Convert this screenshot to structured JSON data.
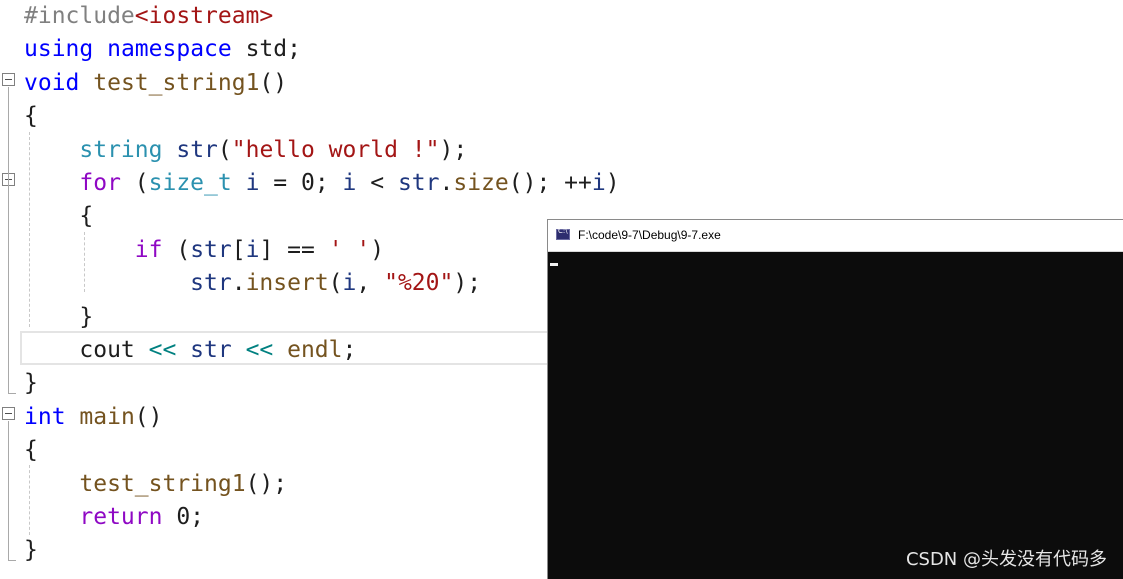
{
  "colors": {
    "preprocessor": "#808080",
    "keyword": "#0000ff",
    "control": "#8f08c4",
    "type": "#2b91af",
    "function": "#74531f",
    "string": "#a31515",
    "plain": "#1e1e1e",
    "console_bg": "#0c0c0c"
  },
  "editor": {
    "lines": [
      {
        "segments": [
          {
            "text": "#include",
            "color": "#808080"
          },
          {
            "text": "<iostream>",
            "color": "#a31515"
          }
        ]
      },
      {
        "segments": [
          {
            "text": "using",
            "color": "#0000ff"
          },
          {
            "text": " ",
            "color": "#1e1e1e"
          },
          {
            "text": "namespace",
            "color": "#0000ff"
          },
          {
            "text": " std;",
            "color": "#1e1e1e"
          }
        ]
      },
      {
        "segments": [
          {
            "text": "void",
            "color": "#0000ff"
          },
          {
            "text": " ",
            "color": "#1e1e1e"
          },
          {
            "text": "test_string1",
            "color": "#74531f"
          },
          {
            "text": "()",
            "color": "#1e1e1e"
          }
        ]
      },
      {
        "segments": [
          {
            "text": "{",
            "color": "#1e1e1e"
          }
        ]
      },
      {
        "segments": [
          {
            "text": "    ",
            "color": "#1e1e1e"
          },
          {
            "text": "string",
            "color": "#2b91af"
          },
          {
            "text": " ",
            "color": "#1e1e1e"
          },
          {
            "text": "str",
            "color": "#1f377f"
          },
          {
            "text": "(",
            "color": "#1e1e1e"
          },
          {
            "text": "\"hello world !\"",
            "color": "#a31515"
          },
          {
            "text": ");",
            "color": "#1e1e1e"
          }
        ]
      },
      {
        "segments": [
          {
            "text": "    ",
            "color": "#1e1e1e"
          },
          {
            "text": "for",
            "color": "#8f08c4"
          },
          {
            "text": " (",
            "color": "#1e1e1e"
          },
          {
            "text": "size_t",
            "color": "#2b91af"
          },
          {
            "text": " ",
            "color": "#1e1e1e"
          },
          {
            "text": "i",
            "color": "#1f377f"
          },
          {
            "text": " = 0; ",
            "color": "#1e1e1e"
          },
          {
            "text": "i",
            "color": "#1f377f"
          },
          {
            "text": " < ",
            "color": "#1e1e1e"
          },
          {
            "text": "str",
            "color": "#1f377f"
          },
          {
            "text": ".",
            "color": "#1e1e1e"
          },
          {
            "text": "size",
            "color": "#74531f"
          },
          {
            "text": "(); ++",
            "color": "#1e1e1e"
          },
          {
            "text": "i",
            "color": "#1f377f"
          },
          {
            "text": ")",
            "color": "#1e1e1e"
          }
        ]
      },
      {
        "segments": [
          {
            "text": "    {",
            "color": "#1e1e1e"
          }
        ]
      },
      {
        "segments": [
          {
            "text": "        ",
            "color": "#1e1e1e"
          },
          {
            "text": "if",
            "color": "#8f08c4"
          },
          {
            "text": " (",
            "color": "#1e1e1e"
          },
          {
            "text": "str",
            "color": "#1f377f"
          },
          {
            "text": "[",
            "color": "#1e1e1e"
          },
          {
            "text": "i",
            "color": "#1f377f"
          },
          {
            "text": "] == ",
            "color": "#1e1e1e"
          },
          {
            "text": "' '",
            "color": "#a31515"
          },
          {
            "text": ")",
            "color": "#1e1e1e"
          }
        ]
      },
      {
        "segments": [
          {
            "text": "            ",
            "color": "#1e1e1e"
          },
          {
            "text": "str",
            "color": "#1f377f"
          },
          {
            "text": ".",
            "color": "#1e1e1e"
          },
          {
            "text": "insert",
            "color": "#74531f"
          },
          {
            "text": "(",
            "color": "#1e1e1e"
          },
          {
            "text": "i",
            "color": "#1f377f"
          },
          {
            "text": ", ",
            "color": "#1e1e1e"
          },
          {
            "text": "\"%20\"",
            "color": "#a31515"
          },
          {
            "text": ");",
            "color": "#1e1e1e"
          }
        ]
      },
      {
        "segments": [
          {
            "text": "    }",
            "color": "#1e1e1e"
          }
        ]
      },
      {
        "segments": [
          {
            "text": "    ",
            "color": "#1e1e1e"
          },
          {
            "text": "cout",
            "color": "#1e1e1e"
          },
          {
            "text": " << ",
            "color": "#008080"
          },
          {
            "text": "str",
            "color": "#1f377f"
          },
          {
            "text": " << ",
            "color": "#008080"
          },
          {
            "text": "endl",
            "color": "#74531f"
          },
          {
            "text": ";",
            "color": "#1e1e1e"
          }
        ]
      },
      {
        "segments": [
          {
            "text": "}",
            "color": "#1e1e1e"
          }
        ]
      },
      {
        "segments": [
          {
            "text": "int",
            "color": "#0000ff"
          },
          {
            "text": " ",
            "color": "#1e1e1e"
          },
          {
            "text": "main",
            "color": "#74531f"
          },
          {
            "text": "()",
            "color": "#1e1e1e"
          }
        ]
      },
      {
        "segments": [
          {
            "text": "{",
            "color": "#1e1e1e"
          }
        ]
      },
      {
        "segments": [
          {
            "text": "    ",
            "color": "#1e1e1e"
          },
          {
            "text": "test_string1",
            "color": "#74531f"
          },
          {
            "text": "();",
            "color": "#1e1e1e"
          }
        ]
      },
      {
        "segments": [
          {
            "text": "    ",
            "color": "#1e1e1e"
          },
          {
            "text": "return",
            "color": "#8f08c4"
          },
          {
            "text": " 0;",
            "color": "#1e1e1e"
          }
        ]
      },
      {
        "segments": [
          {
            "text": "}",
            "color": "#1e1e1e"
          }
        ]
      }
    ]
  },
  "console": {
    "title": "F:\\code\\9-7\\Debug\\9-7.exe",
    "icon": "console-app-icon"
  },
  "watermark": "CSDN @头发没有代码多"
}
